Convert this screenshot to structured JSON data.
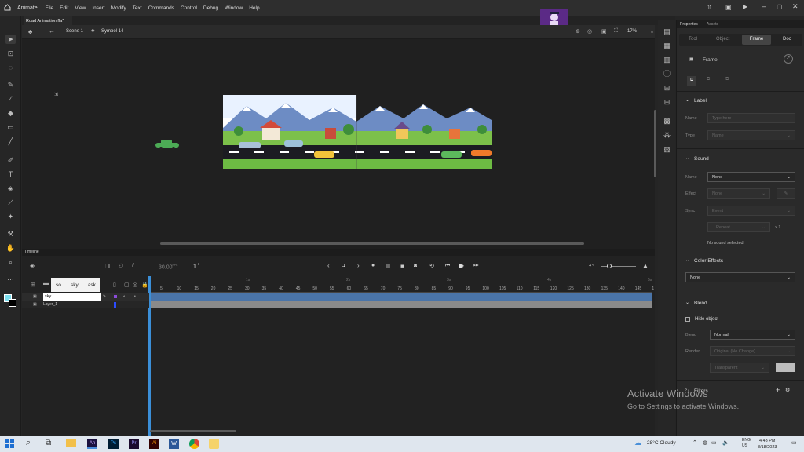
{
  "menu": {
    "app_name": "Animate",
    "items": [
      "File",
      "Edit",
      "View",
      "Insert",
      "Modify",
      "Text",
      "Commands",
      "Control",
      "Debug",
      "Window",
      "Help"
    ]
  },
  "doc_tab": "Road Animation.fla*",
  "editbar": {
    "scene": "Scene 1",
    "symbol": "Symbol 14",
    "zoom": "17%"
  },
  "watermark": {
    "line1": "Activate Windows",
    "line2": "Go to Settings to activate Windows."
  },
  "channel": {
    "name": "Learner Sathi"
  },
  "timeline": {
    "title": "Timeline",
    "fps": "30.00",
    "fps_unit": "FPS",
    "frame": "1",
    "frame_unit": "F",
    "layer_tooltip": [
      "so",
      "sky",
      "ask"
    ],
    "layers": [
      {
        "name": "sky",
        "selected": true
      },
      {
        "name": "Layer_1",
        "selected": false
      }
    ],
    "ruler_labels": [
      "5",
      "10",
      "15",
      "20",
      "25",
      "30",
      "35",
      "40",
      "45",
      "50",
      "55",
      "60",
      "65",
      "70",
      "75",
      "80",
      "85",
      "90",
      "95",
      "100",
      "105",
      "110",
      "115",
      "120",
      "125",
      "130",
      "135",
      "140",
      "145",
      "1"
    ],
    "second_markers": [
      "1s",
      "2s",
      "3s",
      "4s",
      "5s"
    ]
  },
  "properties": {
    "panel_tabs": [
      "Properties",
      "Assets"
    ],
    "subtabs": [
      "Tool",
      "Object",
      "Frame",
      "Doc"
    ],
    "active_subtab": "Frame",
    "header": "Frame",
    "label": {
      "title": "Label",
      "name_label": "Name",
      "name_placeholder": "Type here",
      "type_label": "Type",
      "type_value": "Name"
    },
    "sound": {
      "title": "Sound",
      "name_label": "Name",
      "name_value": "None",
      "effect_label": "Effect",
      "effect_value": "None",
      "sync_label": "Sync",
      "sync_value": "Event",
      "repeat_value": "Repeat",
      "repeat_count": "x 1",
      "status": "No sound selected"
    },
    "color_effects": {
      "title": "Color Effects",
      "value": "None"
    },
    "blend": {
      "title": "Blend",
      "hide_object": "Hide object",
      "blend_label": "Blend",
      "blend_value": "Normal",
      "render_label": "Render",
      "render_value": "Original (No Change)",
      "transparent_value": "Transparent"
    },
    "filters": {
      "title": "Filters"
    }
  },
  "taskbar": {
    "weather": "28°C  Cloudy",
    "lang1": "ENG",
    "lang2": "US",
    "time": "4:43 PM",
    "date": "8/18/2023"
  },
  "colors": {
    "accent": "#3b8fd8",
    "selected_layer": "#3d6ea0",
    "keyframe_bar": "#4a74a8"
  }
}
